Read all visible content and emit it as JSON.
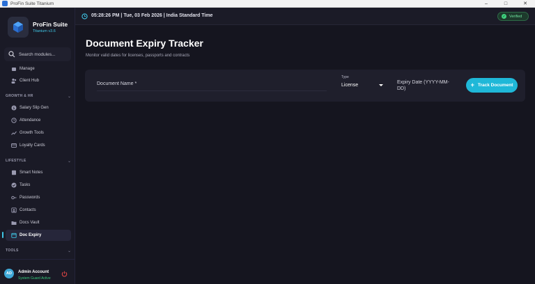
{
  "window": {
    "title": "ProFin Suite Titanium"
  },
  "brand": {
    "name": "ProFin Suite",
    "version": "Titanium v3.6"
  },
  "search": {
    "placeholder": "Search modules..."
  },
  "sidebar": {
    "items_top": [
      {
        "label": "Manage",
        "icon": "manage-icon"
      },
      {
        "label": "Client Hub",
        "icon": "users-icon"
      }
    ],
    "sections": {
      "growth": "GROWTH & HR",
      "lifestyle": "LIFESTYLE",
      "tools": "TOOLS"
    },
    "growth_items": [
      {
        "label": "Salary Slip Gen",
        "icon": "dollar-icon"
      },
      {
        "label": "Attendance",
        "icon": "clock-icon"
      },
      {
        "label": "Growth Tools",
        "icon": "trend-icon"
      },
      {
        "label": "Loyalty Cards",
        "icon": "card-icon"
      }
    ],
    "lifestyle_items": [
      {
        "label": "Smart Notes",
        "icon": "note-icon"
      },
      {
        "label": "Tasks",
        "icon": "check-icon"
      },
      {
        "label": "Passwords",
        "icon": "key-icon"
      },
      {
        "label": "Contacts",
        "icon": "contact-icon"
      },
      {
        "label": "Docs Vault",
        "icon": "folder-icon"
      },
      {
        "label": "Doc Expiry",
        "icon": "calendar-icon"
      }
    ]
  },
  "user": {
    "initials": "AD",
    "name": "Admin Account",
    "status": "System Guard Active"
  },
  "topbar": {
    "datetime": "05:28:26 PM | Tue, 03 Feb 2026 | India Standard Time",
    "verified": "Verified"
  },
  "main": {
    "title": "Document Expiry Tracker",
    "subtitle": "Monitor valid dates for licenses, passports and contracts",
    "form": {
      "doc_name_placeholder": "Document Name *",
      "type_label": "Type",
      "type_value": "License",
      "expiry_placeholder": "Expiry Date (YYYY-MM-DD)",
      "submit_label": "Track Document"
    }
  },
  "colors": {
    "accent": "#1fb8d8",
    "success": "#3fd07e",
    "background": "#15151f"
  }
}
